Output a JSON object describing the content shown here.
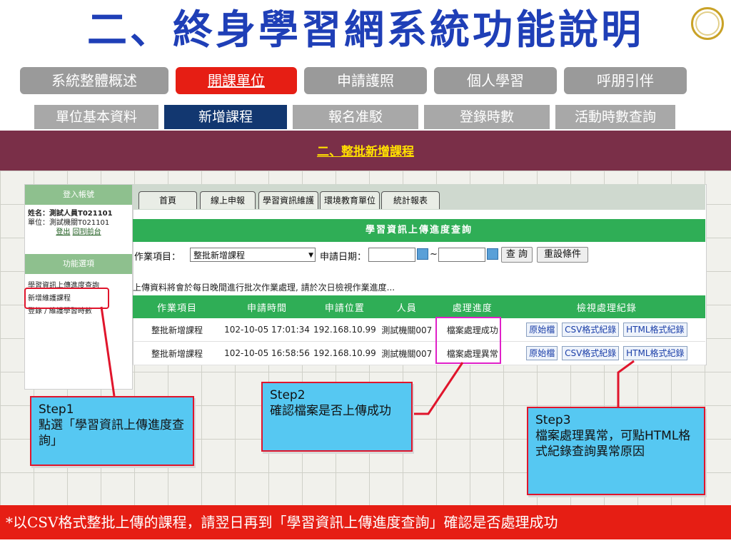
{
  "title": "二、終身學習網系統功能說明",
  "main_tabs": [
    {
      "label": "系統整體概述",
      "active": false
    },
    {
      "label": "開課單位",
      "active": true
    },
    {
      "label": "申請護照",
      "active": false
    },
    {
      "label": "個人學習",
      "active": false
    },
    {
      "label": "呼朋引伴",
      "active": false
    }
  ],
  "sub_tabs": [
    {
      "label": "單位基本資料",
      "active": false
    },
    {
      "label": "新增課程",
      "active": true
    },
    {
      "label": "報名准駁",
      "active": false
    },
    {
      "label": "登錄時數",
      "active": false
    },
    {
      "label": "活動時數查詢",
      "active": false
    }
  ],
  "banner": "二、整批新增課程",
  "sidebar": {
    "login_header": "登入帳號",
    "name_line": "姓名：測試人員T021101",
    "unit_line": "單位：測試機關T021101",
    "logout": "登出",
    "back_home": "回到前台",
    "menu_header": "功能選項",
    "menu_items": [
      "學習資訊上傳進度查詢",
      "新增維護課程",
      "登錄 / 維護學習時數"
    ]
  },
  "app_nav": [
    "首頁",
    "線上申報",
    "學習資訊維護",
    "環境教育單位",
    "統計報表"
  ],
  "panel_title": "學習資訊上傳進度查詢",
  "form": {
    "item_label": "作業項目：",
    "item_value": "整批新增課程",
    "date_label": "申請日期：",
    "date_sep": "~",
    "query_btn": "查 詢",
    "reset_btn": "重設條件"
  },
  "notice": "上傳資料將會於每日晚間進行批次作業處理, 請於次日檢視作業進度...",
  "table": {
    "headers": [
      "作業項目",
      "申請時間",
      "申請位置",
      "人員",
      "處理進度",
      "檢視處理紀錄"
    ],
    "rows": [
      {
        "item": "整批新增課程",
        "time": "102-10-05 17:01:34",
        "ip": "192.168.10.99",
        "person": "測試機關007",
        "status": "檔案處理成功",
        "status_kind": "ok"
      },
      {
        "item": "整批新增課程",
        "time": "102-10-05 16:58:56",
        "ip": "192.168.10.99",
        "person": "測試機關007",
        "status": "檔案處理異常",
        "status_kind": "err"
      }
    ],
    "record_links": [
      "原始檔",
      "CSV格式紀錄",
      "HTML格式紀錄"
    ]
  },
  "steps": {
    "step1_title": "Step1",
    "step1_text": "點選「學習資訊上傳進度查詢」",
    "step2_title": "Step2",
    "step2_text": "確認檔案是否上傳成功",
    "step3_title": "Step3",
    "step3_text": "檔案處理異常，可點HTML格式紀錄查詢異常原因"
  },
  "footer": "*以CSV格式整批上傳的課程，請翌日再到「學習資訊上傳進度查詢」確認是否處理成功",
  "colors": {
    "title": "#1f3fb7",
    "active_tab": "#e61e14",
    "banner": "#7a2f48",
    "green": "#2fae56",
    "step_bg": "#56c8f2"
  }
}
